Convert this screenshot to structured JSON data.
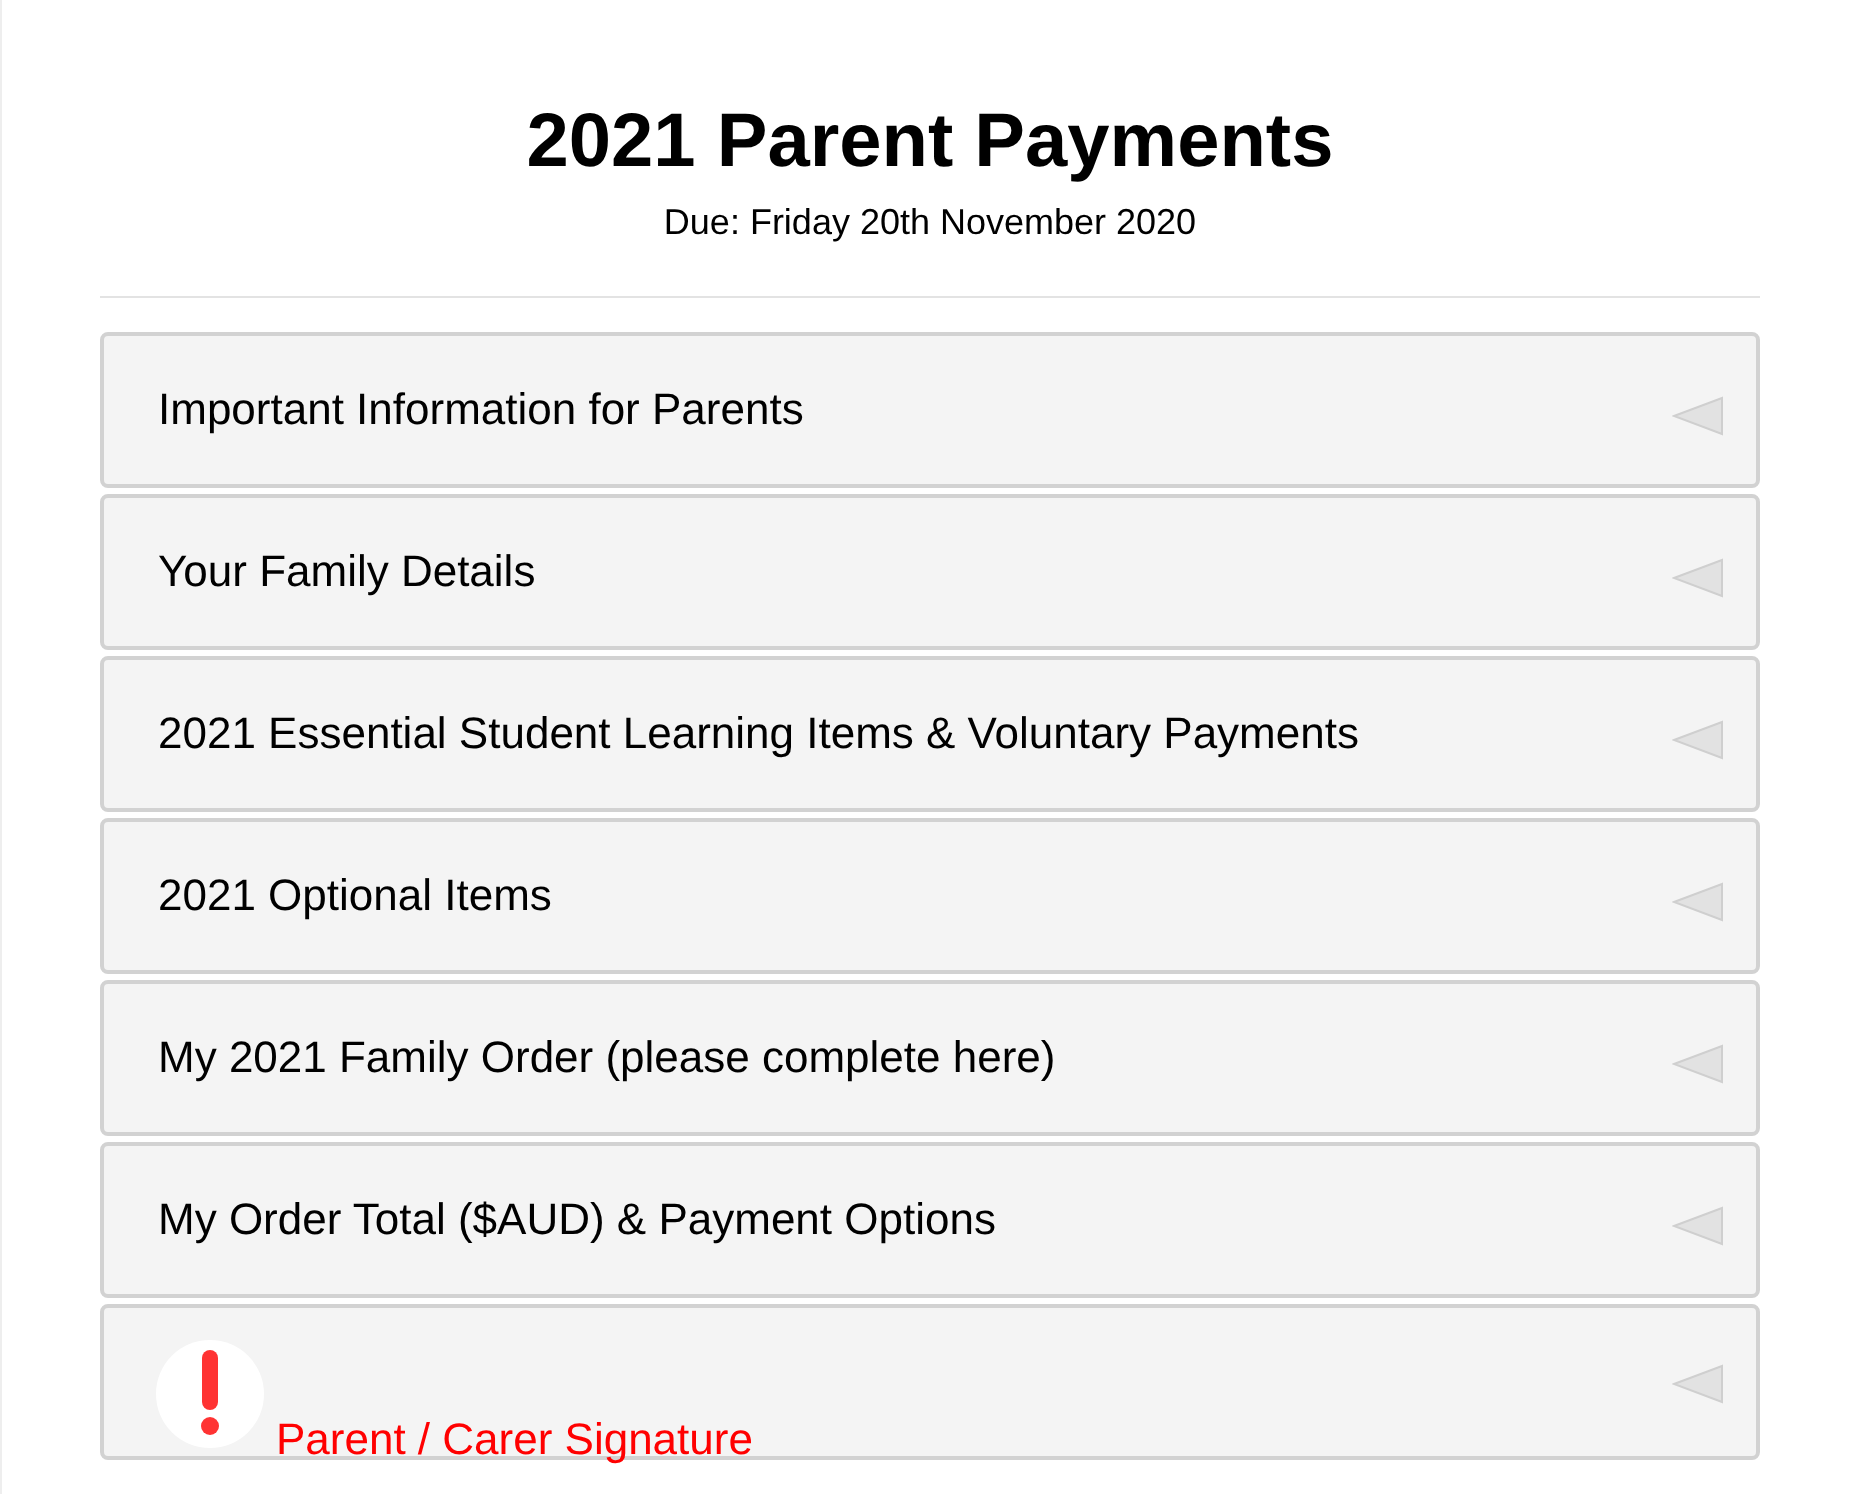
{
  "header": {
    "title": "2021 Parent Payments",
    "subtitle": "Due: Friday 20th November 2020"
  },
  "sections": [
    {
      "kind": "normal",
      "label": "Important Information for Parents",
      "expanded": false
    },
    {
      "kind": "normal",
      "label": "Your Family Details",
      "expanded": false
    },
    {
      "kind": "normal",
      "label": "2021 Essential Student Learning Items & Voluntary Payments",
      "expanded": false
    },
    {
      "kind": "normal",
      "label": "2021 Optional Items",
      "expanded": false
    },
    {
      "kind": "normal",
      "label": "My 2021 Family Order (please complete here)",
      "expanded": false
    },
    {
      "kind": "normal",
      "label": "My Order Total ($AUD) & Payment Options",
      "expanded": false
    },
    {
      "kind": "warning",
      "label": "Parent / Carer Signature",
      "expanded": false
    }
  ]
}
